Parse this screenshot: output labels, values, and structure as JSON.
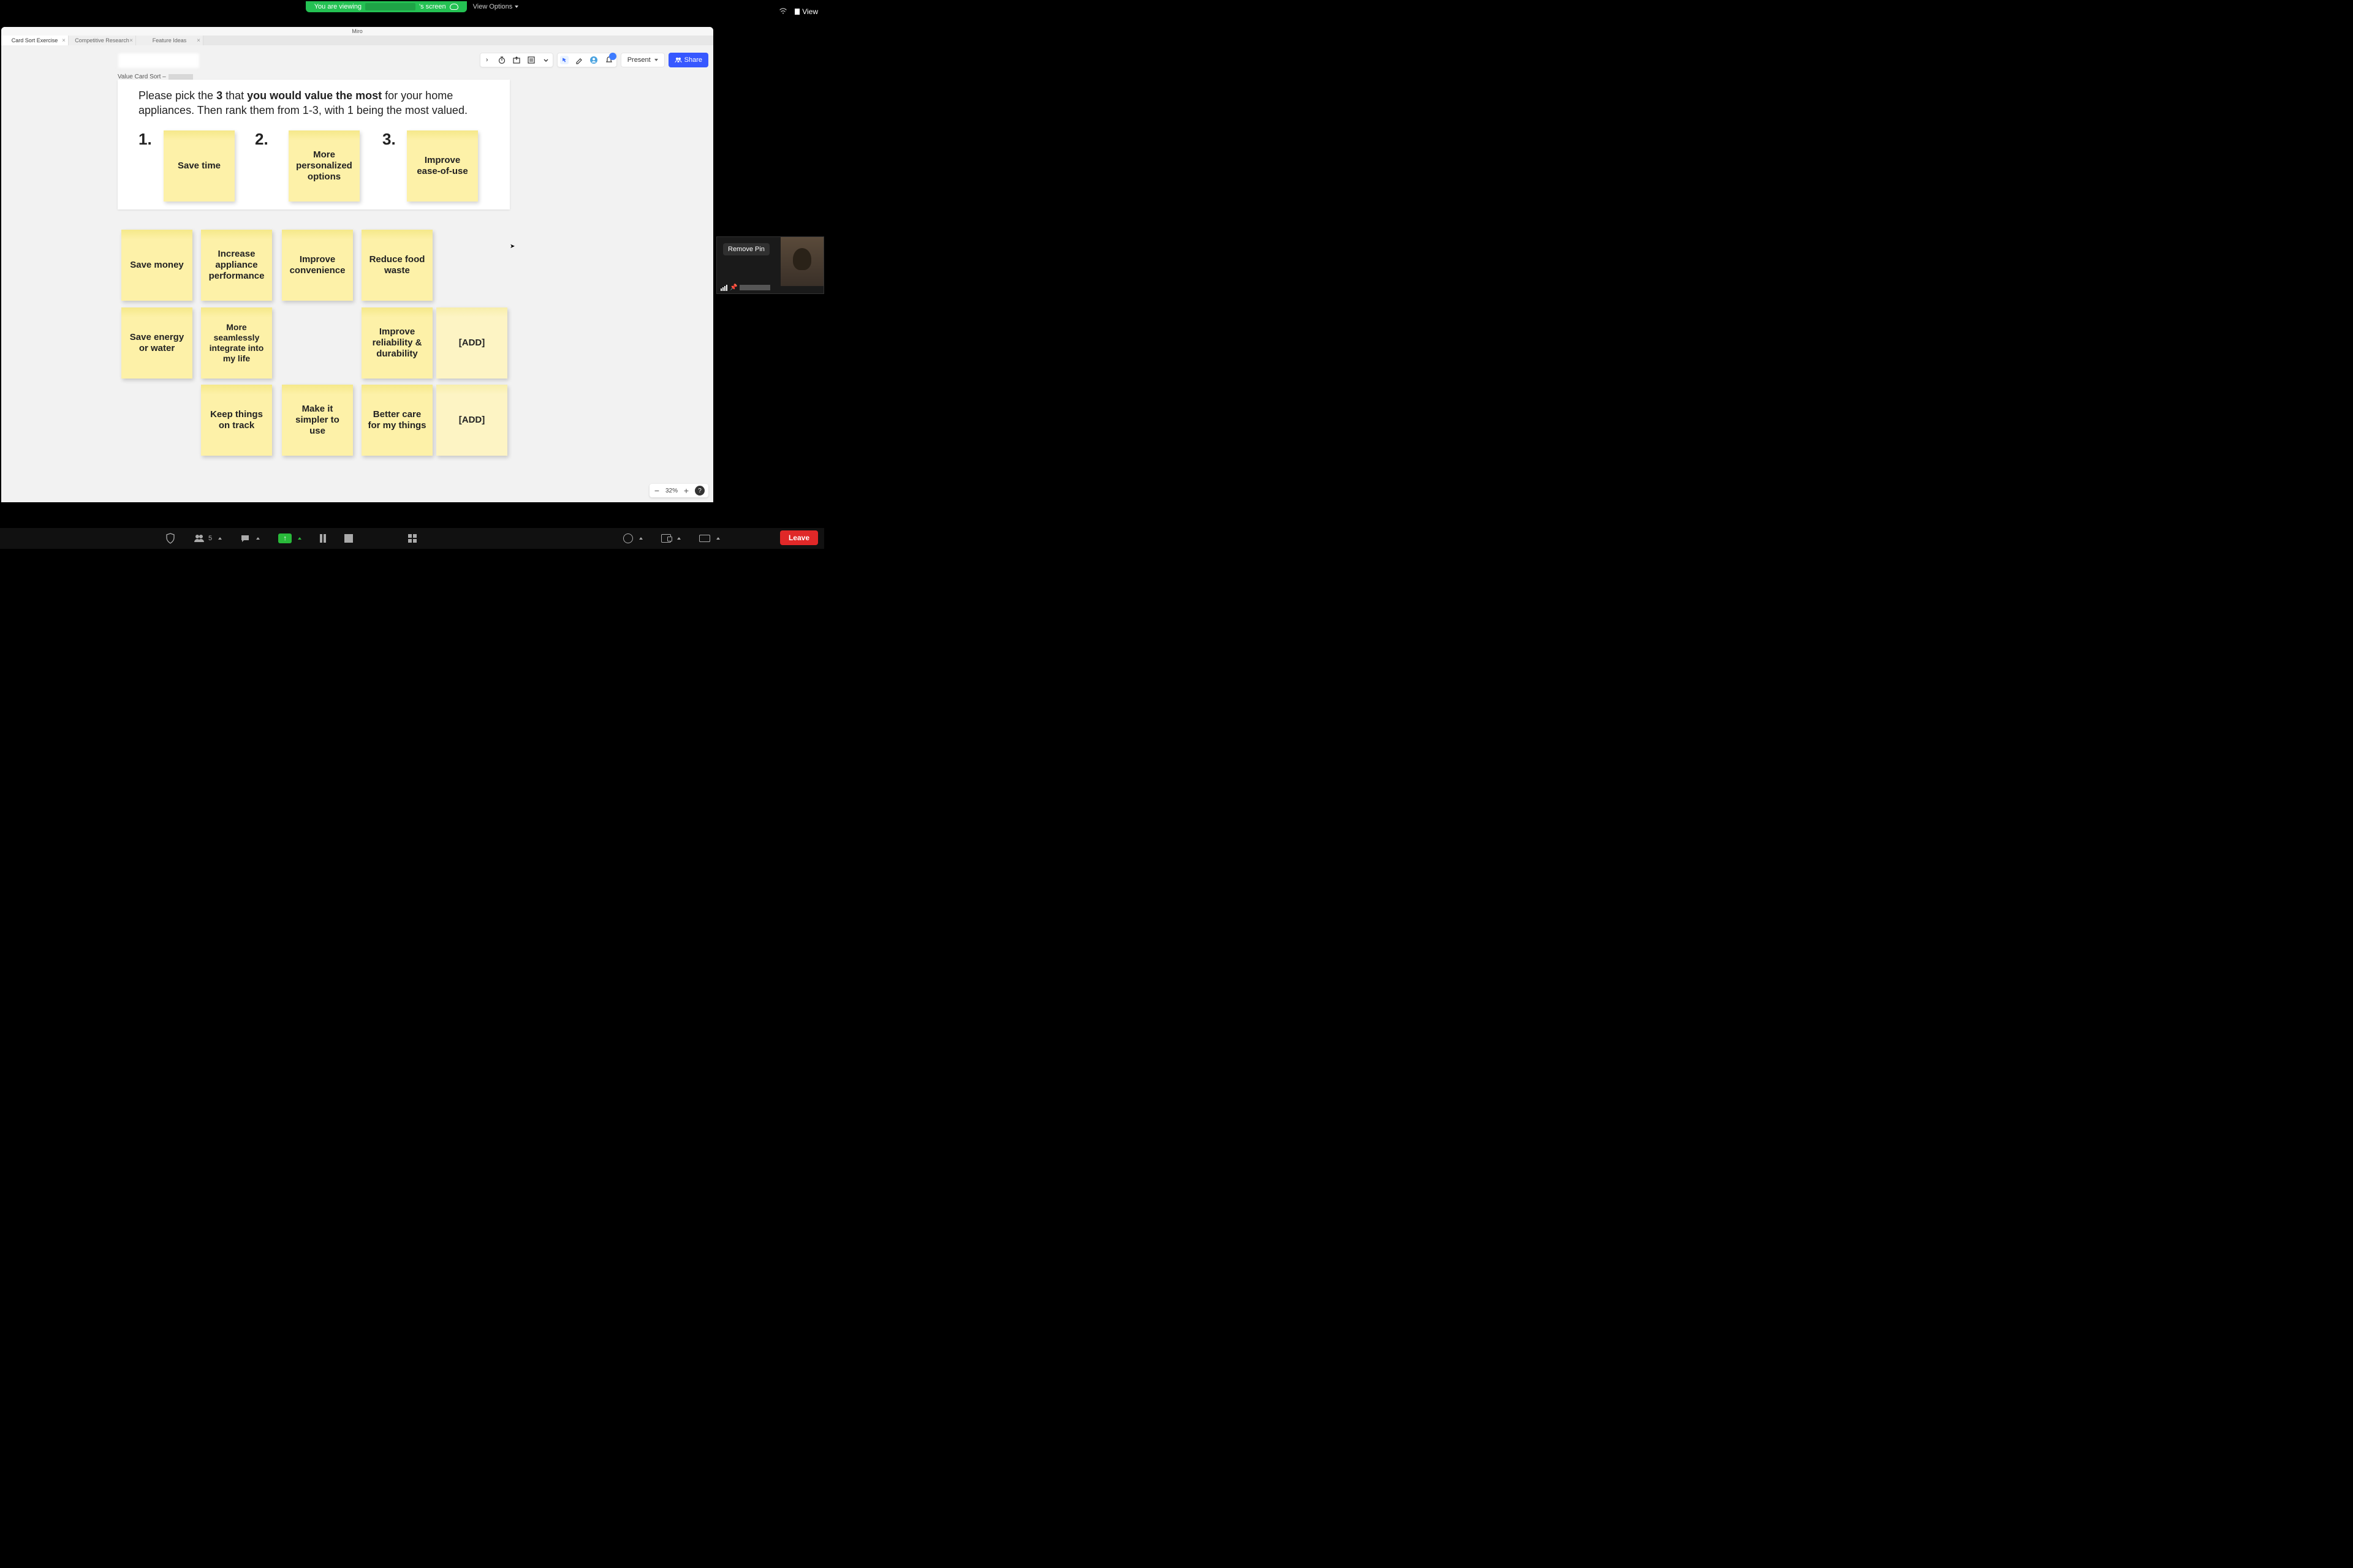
{
  "sharebar": {
    "prefix": "You are viewing ",
    "suffix": "'s screen",
    "view_options": "View Options"
  },
  "top_right": {
    "view": "View"
  },
  "miro": {
    "app_title": "Miro",
    "tabs": [
      {
        "label": "Card Sort Exercise",
        "active": true
      },
      {
        "label": "Competitive Research",
        "active": false
      },
      {
        "label": "Feature Ideas",
        "active": false
      }
    ],
    "board_subtitle_prefix": "Value Card Sort – ",
    "toolbar": {
      "present": "Present",
      "share": "Share"
    },
    "zoom": {
      "minus": "−",
      "level": "32%",
      "plus": "+",
      "help": "?"
    }
  },
  "instruction": {
    "p1_a": "Please pick the ",
    "p1_b": "3",
    "p1_c": " that ",
    "p1_d": "you would value the most",
    "p1_e": " for your home appliances. Then rank them from 1-3, with 1 being the most valued."
  },
  "ranks": {
    "r1": "1.",
    "r2": "2.",
    "r3": "3."
  },
  "stickies": {
    "top": [
      "Save time",
      "More personalized options",
      "Improve ease-of-use"
    ],
    "grid": [
      "Save money",
      "Increase appliance performance",
      "Improve convenience",
      "Reduce food waste",
      "Save energy or water",
      "More seamlessly integrate into my life",
      "Improve reliability & durability",
      "[ADD]",
      "Keep things on track",
      "Make it simpler to use",
      "Better care for my things",
      "[ADD]"
    ]
  },
  "video": {
    "remove_pin": "Remove Pin"
  },
  "bottombar": {
    "participants_count": "5",
    "leave": "Leave"
  }
}
